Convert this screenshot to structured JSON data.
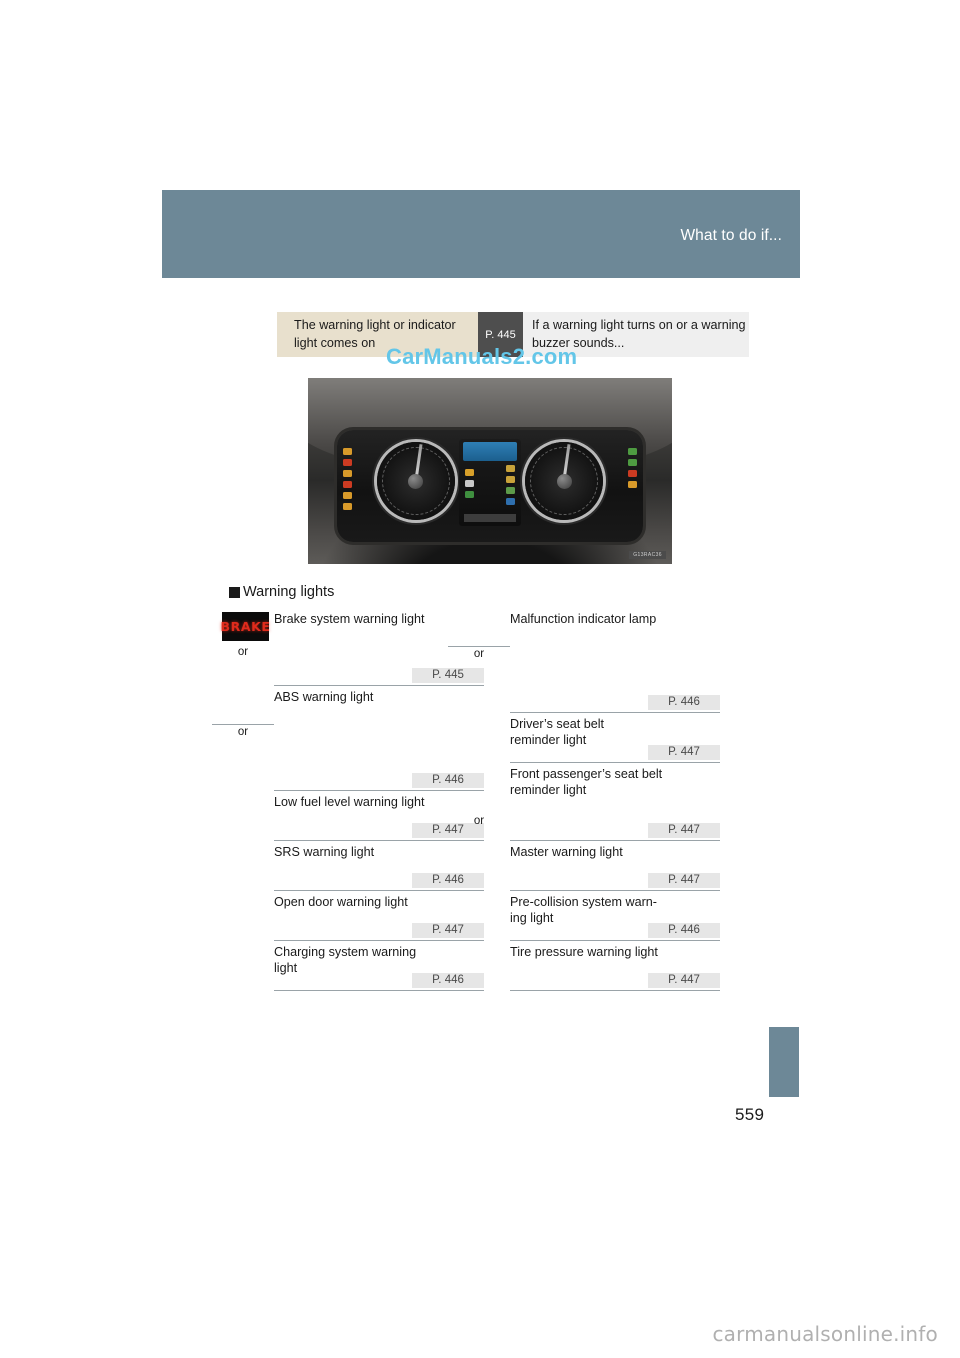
{
  "page": {
    "number": "559",
    "header_title": "What to do if...",
    "watermark_center": "CarManuals2.com",
    "watermark_bottom": "carmanualsonline.info",
    "accent_color": "#6d8897",
    "flow_box_color": "#e8e0cd",
    "chip_color": "#4e4e4e",
    "ref_chip_color": "#e6e6e6"
  },
  "flow": {
    "source": {
      "line1": "The warning light or indicator",
      "line2": "light comes on"
    },
    "chip": "P. 445",
    "target": {
      "line1": "If a warning light turns on or a warning",
      "line2": "buzzer sounds..."
    }
  },
  "photo": {
    "caption_tag": "G13RAC36",
    "alt": "instrument-cluster"
  },
  "section": {
    "heading": "Warning lights"
  },
  "warning_lights": {
    "left_column": [
      {
        "label": "Brake system warning light",
        "ref": "P. 445",
        "icon": "brake-text-icon",
        "icon_text": "BRAKE",
        "or_label": "or",
        "or_ruled": false
      },
      {
        "label": "ABS warning light",
        "ref": "P. 446",
        "icon": "abs-warning-icon",
        "or_label": "or",
        "or_ruled": true
      },
      {
        "label": "Low fuel level warning light",
        "ref": "P. 447",
        "icon": "low-fuel-icon"
      },
      {
        "label": "SRS warning light",
        "ref": "P. 446",
        "icon": "srs-airbag-icon"
      },
      {
        "label": "Open door warning light",
        "ref": "P. 447",
        "icon": "open-door-icon"
      },
      {
        "label": "Charging system warning\nlight",
        "ref": "P. 446",
        "icon": "charging-system-icon"
      }
    ],
    "right_column": [
      {
        "label": "Malfunction indicator lamp",
        "ref": "P. 446",
        "icon": "malfunction-indicator-icon",
        "or_label": "or",
        "or_ruled": true
      },
      {
        "label": "Driver’s seat belt\nreminder light",
        "ref": "P. 447",
        "icon": "driver-seatbelt-icon"
      },
      {
        "label": "Front passenger’s seat belt\nreminder light",
        "ref": "P. 447",
        "icon": "passenger-seatbelt-icon",
        "or_label": "or",
        "or_ruled": false
      },
      {
        "label": "Master warning light",
        "ref": "P. 447",
        "icon": "master-warning-icon"
      },
      {
        "label": "Pre-collision system warn-\ning light",
        "ref": "P. 446",
        "icon": "pre-collision-icon"
      },
      {
        "label": "Tire pressure warning light",
        "ref": "P. 447",
        "icon": "tire-pressure-icon"
      }
    ]
  }
}
